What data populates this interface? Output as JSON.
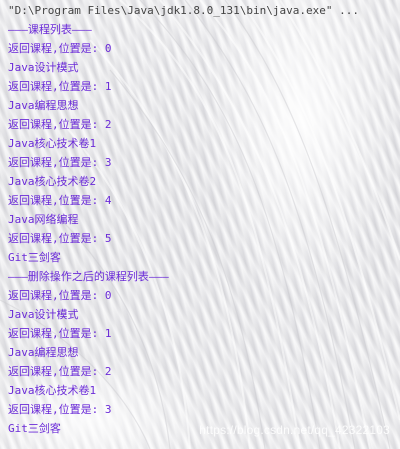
{
  "console": {
    "command": "\"D:\\Program Files\\Java\\jdk1.8.0_131\\bin\\java.exe\" ...",
    "lines": [
      "———课程列表———",
      "返回课程,位置是: 0",
      "Java设计模式",
      "返回课程,位置是: 1",
      "Java编程思想",
      "返回课程,位置是: 2",
      "Java核心技术卷1",
      "返回课程,位置是: 3",
      "Java核心技术卷2",
      "返回课程,位置是: 4",
      "Java网络编程",
      "返回课程,位置是: 5",
      "Git三剑客",
      "———删除操作之后的课程列表———",
      "返回课程,位置是: 0",
      "Java设计模式",
      "返回课程,位置是: 1",
      "Java编程思想",
      "返回课程,位置是: 2",
      "Java核心技术卷1",
      "返回课程,位置是: 3",
      "Git三剑客"
    ]
  },
  "watermark": "https://blog.csdn.net/qq_42322103",
  "colors": {
    "output_text": "#6b2bd8",
    "command_text": "#444444"
  }
}
